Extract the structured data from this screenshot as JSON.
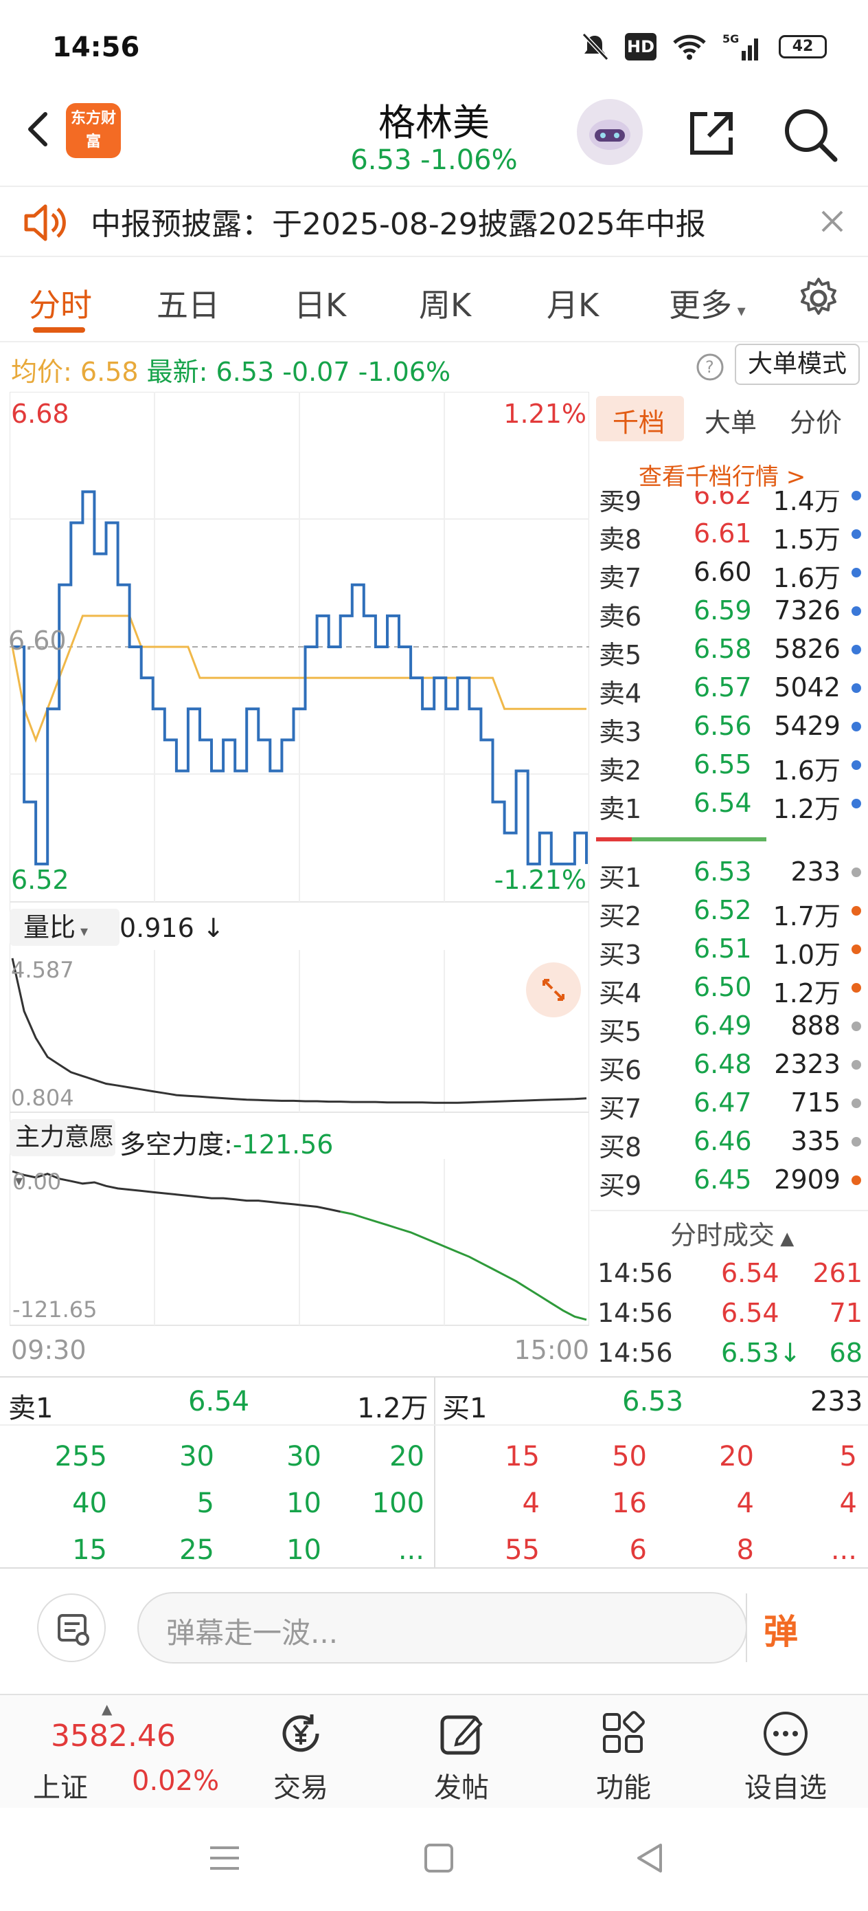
{
  "status": {
    "time": "14:56",
    "battery": "42"
  },
  "header": {
    "logo_text": "东方财富",
    "stock_name": "格林美",
    "price_line": "6.53  -1.06%"
  },
  "notice": {
    "text": "中报预披露：于2025-08-29披露2025年中报"
  },
  "tabs": [
    "分时",
    "五日",
    "日K",
    "周K",
    "月K",
    "更多"
  ],
  "info": {
    "avg_label": "均价:",
    "avg_value": "6.58",
    "latest_label": "最新:",
    "latest_value": "6.53",
    "change": "-0.07",
    "change_pct": "-1.06%",
    "big_mode": "大单模式"
  },
  "chart": {
    "high_price": "6.68",
    "high_pct": "1.21%",
    "low_price": "6.52",
    "low_pct": "-1.21%",
    "mid_price": "6.60",
    "vol_ratio_label": "量比",
    "vol_ratio_value": "0.916",
    "vol_ratio_arrow": "↓",
    "vol_ratio_max": "4.587",
    "vol_ratio_min": "0.804",
    "main_label": "主力意愿",
    "force_label": "多空力度:",
    "force_value": "-121.56",
    "force_top": "0.00",
    "force_bottom": "-121.65",
    "time_start": "09:30",
    "time_end": "15:00"
  },
  "chart_data": {
    "type": "line",
    "title": "",
    "xlabel": "",
    "ylabel": "",
    "x_range": [
      "09:30",
      "15:00"
    ],
    "ylim": [
      6.52,
      6.68
    ],
    "series": [],
    "price": [
      6.6,
      6.55,
      6.53,
      6.58,
      6.62,
      6.64,
      6.65,
      6.63,
      6.64,
      6.62,
      6.6,
      6.59,
      6.58,
      6.57,
      6.56,
      6.58,
      6.57,
      6.56,
      6.57,
      6.56,
      6.58,
      6.57,
      6.56,
      6.57,
      6.58,
      6.6,
      6.61,
      6.6,
      6.61,
      6.62,
      6.61,
      6.6,
      6.61,
      6.6,
      6.59,
      6.58,
      6.59,
      6.58,
      6.59,
      6.58,
      6.57,
      6.55,
      6.54,
      6.56,
      6.53,
      6.54,
      6.53,
      6.53,
      6.54,
      6.53
    ],
    "avg": [
      6.6,
      6.58,
      6.57,
      6.58,
      6.59,
      6.6,
      6.61,
      6.61,
      6.61,
      6.61,
      6.61,
      6.6,
      6.6,
      6.6,
      6.6,
      6.6,
      6.59,
      6.59,
      6.59,
      6.59,
      6.59,
      6.59,
      6.59,
      6.59,
      6.59,
      6.59,
      6.59,
      6.59,
      6.59,
      6.59,
      6.59,
      6.59,
      6.59,
      6.59,
      6.59,
      6.59,
      6.59,
      6.59,
      6.59,
      6.59,
      6.59,
      6.59,
      6.58,
      6.58,
      6.58,
      6.58,
      6.58,
      6.58,
      6.58,
      6.58
    ],
    "vol_ratio": [
      4.587,
      3.2,
      2.5,
      2.0,
      1.8,
      1.6,
      1.5,
      1.4,
      1.3,
      1.25,
      1.2,
      1.15,
      1.1,
      1.05,
      1.0,
      0.98,
      0.96,
      0.94,
      0.92,
      0.9,
      0.88,
      0.87,
      0.86,
      0.85,
      0.85,
      0.84,
      0.84,
      0.83,
      0.83,
      0.82,
      0.82,
      0.82,
      0.81,
      0.81,
      0.81,
      0.81,
      0.8,
      0.8,
      0.8,
      0.81,
      0.82,
      0.83,
      0.84,
      0.85,
      0.86,
      0.87,
      0.88,
      0.89,
      0.9,
      0.916
    ],
    "force": [
      0,
      -3,
      -5,
      -2,
      -6,
      -8,
      -10,
      -9,
      -12,
      -14,
      -15,
      -16,
      -17,
      -18,
      -19,
      -20,
      -21,
      -22,
      -22,
      -23,
      -24,
      -24,
      -25,
      -26,
      -27,
      -28,
      -29,
      -31,
      -33,
      -35,
      -38,
      -41,
      -44,
      -47,
      -50,
      -54,
      -58,
      -62,
      -66,
      -70,
      -75,
      -80,
      -85,
      -90,
      -96,
      -102,
      -108,
      -114,
      -119,
      -121.56
    ]
  },
  "orderbook": {
    "tabs": [
      "千档",
      "大单",
      "分价"
    ],
    "view_more": "查看千档行情 >",
    "sells": [
      {
        "label": "卖9",
        "price": "6.62",
        "vol": "1.4万",
        "dot": "blue"
      },
      {
        "label": "卖8",
        "price": "6.61",
        "vol": "1.5万",
        "dot": "blue"
      },
      {
        "label": "卖7",
        "price": "6.60",
        "vol": "1.6万",
        "dot": "blue"
      },
      {
        "label": "卖6",
        "price": "6.59",
        "vol": "7326",
        "dot": "blue"
      },
      {
        "label": "卖5",
        "price": "6.58",
        "vol": "5826",
        "dot": "blue"
      },
      {
        "label": "卖4",
        "price": "6.57",
        "vol": "5042",
        "dot": "blue"
      },
      {
        "label": "卖3",
        "price": "6.56",
        "vol": "5429",
        "dot": "blue"
      },
      {
        "label": "卖2",
        "price": "6.55",
        "vol": "1.6万",
        "dot": "blue"
      },
      {
        "label": "卖1",
        "price": "6.54",
        "vol": "1.2万",
        "dot": "blue"
      }
    ],
    "buys": [
      {
        "label": "买1",
        "price": "6.53",
        "vol": "233",
        "dot": "gray"
      },
      {
        "label": "买2",
        "price": "6.52",
        "vol": "1.7万",
        "dot": "orange"
      },
      {
        "label": "买3",
        "price": "6.51",
        "vol": "1.0万",
        "dot": "orange"
      },
      {
        "label": "买4",
        "price": "6.50",
        "vol": "1.2万",
        "dot": "orange"
      },
      {
        "label": "买5",
        "price": "6.49",
        "vol": "888",
        "dot": "gray"
      },
      {
        "label": "买6",
        "price": "6.48",
        "vol": "2323",
        "dot": "gray"
      },
      {
        "label": "买7",
        "price": "6.47",
        "vol": "715",
        "dot": "gray"
      },
      {
        "label": "买8",
        "price": "6.46",
        "vol": "335",
        "dot": "gray"
      },
      {
        "label": "买9",
        "price": "6.45",
        "vol": "2909",
        "dot": "orange"
      }
    ],
    "ticks_header": "分时成交",
    "ticks": [
      {
        "time": "14:56",
        "price": "6.54",
        "vol": "261"
      },
      {
        "time": "14:56",
        "price": "6.54",
        "vol": "71"
      },
      {
        "time": "14:56",
        "price": "6.53↓",
        "vol": "68"
      }
    ]
  },
  "summary": {
    "sell_label": "卖1",
    "sell_price": "6.54",
    "sell_vol": "1.2万",
    "buy_label": "买1",
    "buy_price": "6.53",
    "buy_vol": "233",
    "sell_rows": [
      [
        "255",
        "30",
        "30",
        "20"
      ],
      [
        "40",
        "5",
        "10",
        "100"
      ],
      [
        "15",
        "25",
        "10",
        "..."
      ]
    ],
    "buy_rows": [
      [
        "15",
        "50",
        "20",
        "5"
      ],
      [
        "4",
        "16",
        "4",
        "4"
      ],
      [
        "55",
        "6",
        "8",
        "..."
      ]
    ]
  },
  "comment": {
    "placeholder": "弹幕走一波...",
    "danmu_label": "弹"
  },
  "bottomnav": {
    "index_value": "3582.46",
    "index_name": "上证",
    "index_pct": "0.02%",
    "items": [
      "交易",
      "发帖",
      "功能",
      "设自选"
    ]
  }
}
